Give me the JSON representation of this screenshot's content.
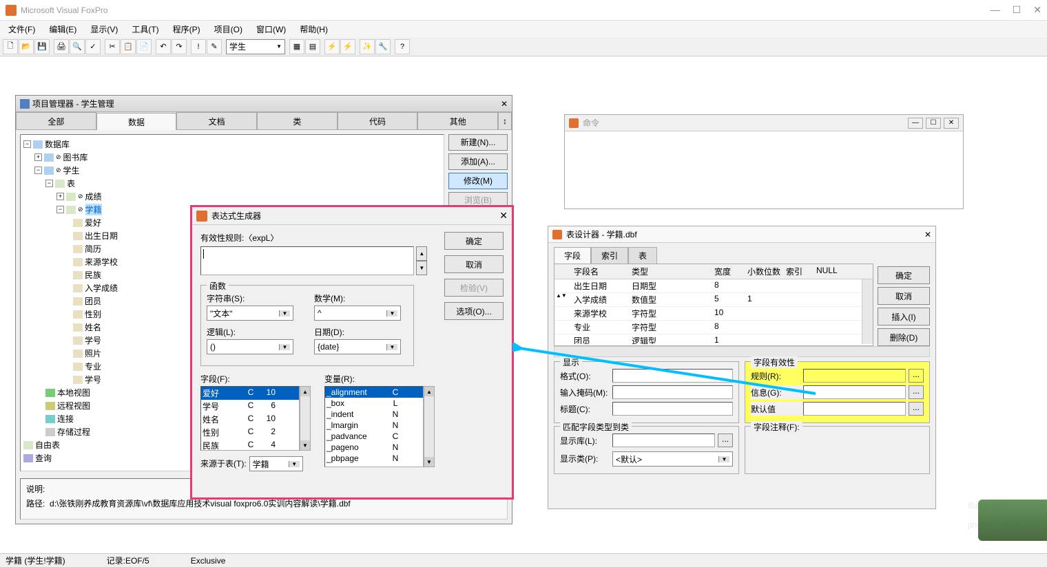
{
  "app": {
    "title": "Microsoft Visual FoxPro"
  },
  "menu": [
    "文件(F)",
    "编辑(E)",
    "显示(V)",
    "工具(T)",
    "程序(P)",
    "项目(O)",
    "窗口(W)",
    "帮助(H)"
  ],
  "toolbar_combo": "学生",
  "pm": {
    "title": "项目管理器 - 学生管理",
    "tabs": [
      "全部",
      "数据",
      "文档",
      "类",
      "代码",
      "其他"
    ],
    "buttons": {
      "new": "新建(N)...",
      "add": "添加(A)...",
      "modify": "修改(M)",
      "browse": "浏览(B)"
    },
    "tree": {
      "root": "数据库",
      "lib": "图书库",
      "student": "学生",
      "tables": "表",
      "score": "成绩",
      "xueji": "学籍",
      "fields": [
        "爱好",
        "出生日期",
        "简历",
        "来源学校",
        "民族",
        "入学成绩",
        "团员",
        "性别",
        "姓名",
        "学号",
        "照片",
        "专业",
        "学号"
      ],
      "localview": "本地视图",
      "remoteview": "远程视图",
      "connection": "连接",
      "storedproc": "存储过程",
      "freetable": "自由表",
      "query": "查询"
    },
    "footer": {
      "desc_label": "说明:",
      "path_label": "路径:",
      "path": "d:\\张铁刚养成教育资源库\\vf\\数据库应用技术visual foxpro6.0实训内容解读\\学籍.dbf"
    }
  },
  "expr": {
    "title": "表达式生成器",
    "rule_label": "有效性规则:〈expL〉",
    "btns": {
      "ok": "确定",
      "cancel": "取消",
      "verify": "检验(V)",
      "options": "选项(O)..."
    },
    "func_legend": "函数",
    "string_label": "字符串(S):",
    "string_val": "\"文本\"",
    "math_label": "数学(M):",
    "math_val": "^",
    "logic_label": "逻辑(L):",
    "logic_val": "()",
    "date_label": "日期(D):",
    "date_val": "{date}",
    "fields_label": "字段(F):",
    "vars_label": "变量(R):",
    "fields": [
      {
        "n": "爱好",
        "t": "C",
        "w": "10"
      },
      {
        "n": "学号",
        "t": "C",
        "w": "6"
      },
      {
        "n": "姓名",
        "t": "C",
        "w": "10"
      },
      {
        "n": "性别",
        "t": "C",
        "w": "2"
      },
      {
        "n": "民族",
        "t": "C",
        "w": "4"
      }
    ],
    "vars": [
      {
        "n": "_alignment",
        "t": "C"
      },
      {
        "n": "_box",
        "t": "L"
      },
      {
        "n": "_indent",
        "t": "N"
      },
      {
        "n": "_lmargin",
        "t": "N"
      },
      {
        "n": "_padvance",
        "t": "C"
      },
      {
        "n": "_pageno",
        "t": "N"
      },
      {
        "n": "_pbpage",
        "t": "N"
      }
    ],
    "from_table_label": "来源于表(T):",
    "from_table": "学籍"
  },
  "cmd": {
    "title": "命令"
  },
  "td": {
    "title": "表设计器 - 学籍.dbf",
    "tabs": [
      "字段",
      "索引",
      "表"
    ],
    "hdr": {
      "name": "字段名",
      "type": "类型",
      "width": "宽度",
      "dec": "小数位数",
      "idx": "索引",
      "null": "NULL"
    },
    "rows": [
      {
        "n": "出生日期",
        "t": "日期型",
        "w": "8",
        "d": ""
      },
      {
        "n": "入学成绩",
        "t": "数值型",
        "w": "5",
        "d": "1"
      },
      {
        "n": "来源学校",
        "t": "字符型",
        "w": "10",
        "d": ""
      },
      {
        "n": "专业",
        "t": "字符型",
        "w": "8",
        "d": ""
      },
      {
        "n": "团员",
        "t": "逻辑型",
        "w": "1",
        "d": ""
      }
    ],
    "btns": {
      "ok": "确定",
      "cancel": "取消",
      "insert": "插入(I)",
      "delete": "删除(D)"
    },
    "display": {
      "legend": "显示",
      "format": "格式(O):",
      "mask": "输入掩码(M):",
      "caption": "标题(C):"
    },
    "valid": {
      "legend": "字段有效性",
      "rule": "规则(R):",
      "msg": "信息(G):",
      "default": "默认值"
    },
    "match": {
      "legend": "匹配字段类型到类",
      "lib": "显示库(L):",
      "cls": "显示类(P):",
      "cls_val": "<默认>"
    },
    "comment": {
      "legend": "字段注释(F):"
    }
  },
  "status": {
    "table": "学籍 (学生!学籍)",
    "record": "记录:EOF/5",
    "mode": "Exclusive"
  },
  "watermark": "Baidu 经验"
}
